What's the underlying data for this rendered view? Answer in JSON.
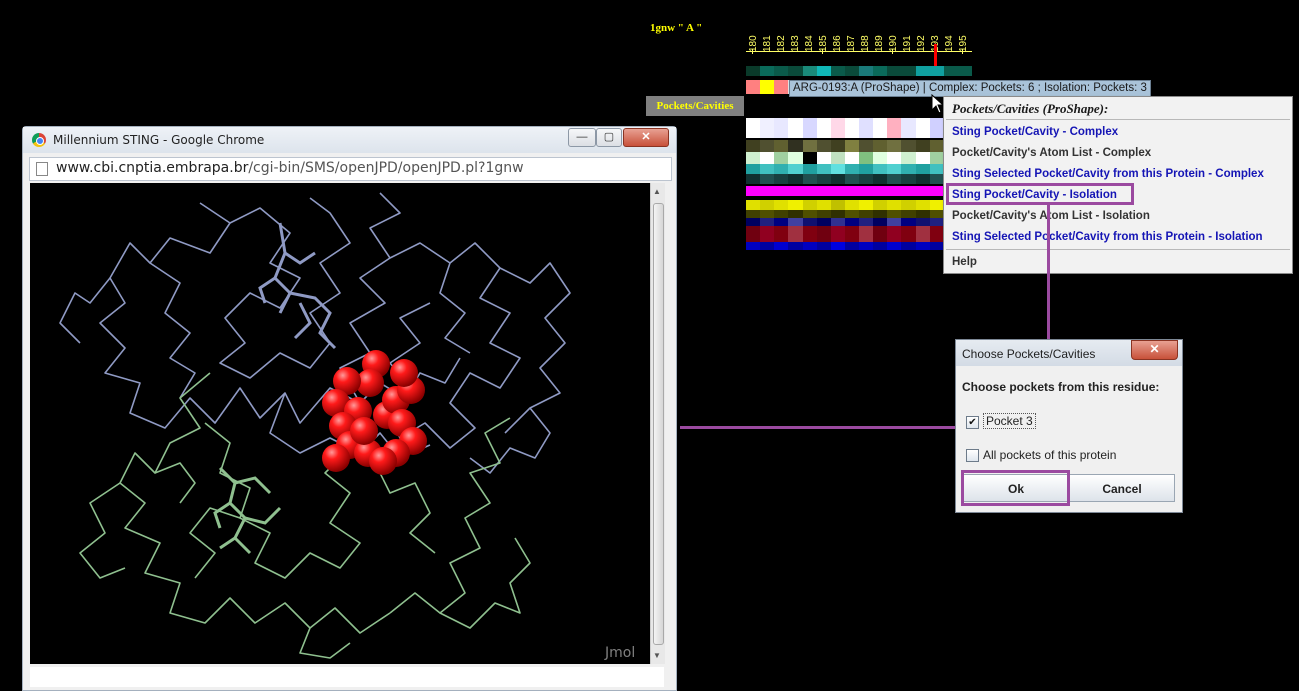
{
  "sequence": {
    "chain_label": "1gnw \" A \"",
    "residue_numbers": [
      "180",
      "181",
      "182",
      "183",
      "184",
      "185",
      "186",
      "187",
      "188",
      "189",
      "190",
      "191",
      "192",
      "193",
      "194",
      "195"
    ],
    "selected_residue": "193",
    "property_label": "Pockets/Cavities",
    "tooltip": "ARG-0193:A (ProShape) | Complex: Pockets: 6 ;  Isolation: Pockets: 3"
  },
  "context_menu": {
    "title": "Pockets/Cavities (ProShape):",
    "items": [
      {
        "label": "Sting Pocket/Cavity - Complex",
        "style": "blue"
      },
      {
        "label": "Pocket/Cavity's Atom List - Complex",
        "style": "dark"
      },
      {
        "label": "Sting Selected Pocket/Cavity from this Protein - Complex",
        "style": "blue"
      },
      {
        "label": "Sting Pocket/Cavity - Isolation",
        "style": "blue"
      },
      {
        "label": "Pocket/Cavity's Atom List - Isolation",
        "style": "dark"
      },
      {
        "label": "Sting Selected Pocket/Cavity from this Protein - Isolation",
        "style": "blue"
      }
    ],
    "help_label": "Help"
  },
  "browser": {
    "title": "Millennium STING - Google Chrome",
    "url_host": "www.cbi.cnptia.embrapa.br",
    "url_path": "/cgi-bin/SMS/openJPD/openJPD.pl?1gnw",
    "viewer_watermark": "Jmol",
    "minimize_label": "—",
    "maximize_label": "▢",
    "close_label": "✕"
  },
  "dialog": {
    "title": "Choose Pockets/Cavities",
    "close_label": "✕",
    "prompt": "Choose pockets from this residue:",
    "options": [
      {
        "label": "Pocket 3",
        "checked": true
      },
      {
        "label": "All pockets of this protein",
        "checked": false
      }
    ],
    "ok_label": "Ok",
    "cancel_label": "Cancel"
  },
  "colors": {
    "annotation": "#9b4aa0",
    "atom_spheres": "#ff0000",
    "chain_a_trace": "#8f9ac4",
    "chain_b_trace": "#8fc08f"
  }
}
